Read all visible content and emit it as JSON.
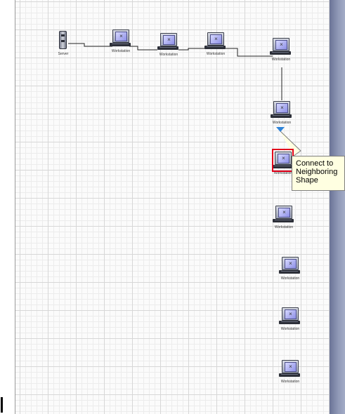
{
  "diagram": {
    "server": {
      "label": "Server"
    },
    "workstations": [
      {
        "id": "ws1",
        "label": "Workstation"
      },
      {
        "id": "ws2",
        "label": "Workstation"
      },
      {
        "id": "ws3",
        "label": "Workstation"
      },
      {
        "id": "ws4",
        "label": "Workstation"
      },
      {
        "id": "ws5",
        "label": "Workstation"
      },
      {
        "id": "ws6",
        "label": "Workstation"
      },
      {
        "id": "ws7",
        "label": "Workstation"
      },
      {
        "id": "ws8",
        "label": "Workstation"
      },
      {
        "id": "ws9",
        "label": "Workstation"
      },
      {
        "id": "ws10",
        "label": "Workstation"
      }
    ],
    "selected": "ws6",
    "connector_color": "#222222",
    "selection_color": "#e2001a",
    "handle_color": "#2f84d8"
  },
  "tooltip": {
    "line1": "Connect to",
    "line2": "Neighboring",
    "line3": "Shape"
  }
}
